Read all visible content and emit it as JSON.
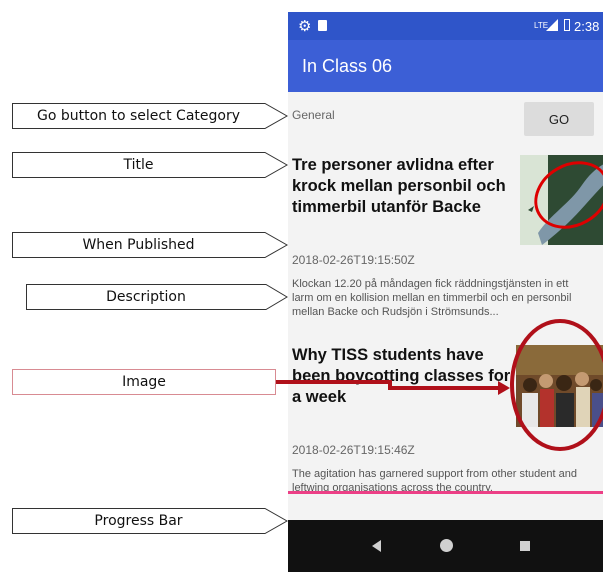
{
  "annotations": {
    "go_button": "Go button to select Category",
    "title": "Title",
    "when_published": "When Published",
    "description": "Description",
    "image": "Image",
    "progress_bar": "Progress Bar"
  },
  "status_bar": {
    "time": "2:38",
    "network": "LTE"
  },
  "app": {
    "title": "In Class 06"
  },
  "category": {
    "selected": "General",
    "go_label": "GO"
  },
  "articles": [
    {
      "title": "Tre personer avlidna efter krock mellan personbil och timmerbil utanför Backe",
      "date": "2018-02-26T19:15:50Z",
      "desc_line1": "Klockan 12.20 på måndagen fick räddningstjänsten in ett",
      "desc_line2": "larm om en kollision mellan en timmerbil och en personbil",
      "desc_line3": "mellan Backe och Rudsjön i Strömsunds..."
    },
    {
      "title": "Why TISS students have been boycotting classes for a week",
      "date": "2018-02-26T19:15:46Z",
      "desc_line1": "The agitation has garnered support from other student and",
      "desc_line2": "leftwing organisations across the country."
    }
  ],
  "colors": {
    "status_bar": "#2f55c9",
    "app_bar": "#3c5fd6",
    "progress": "#ec3f86",
    "annotation_arrow": "#b0101a"
  }
}
